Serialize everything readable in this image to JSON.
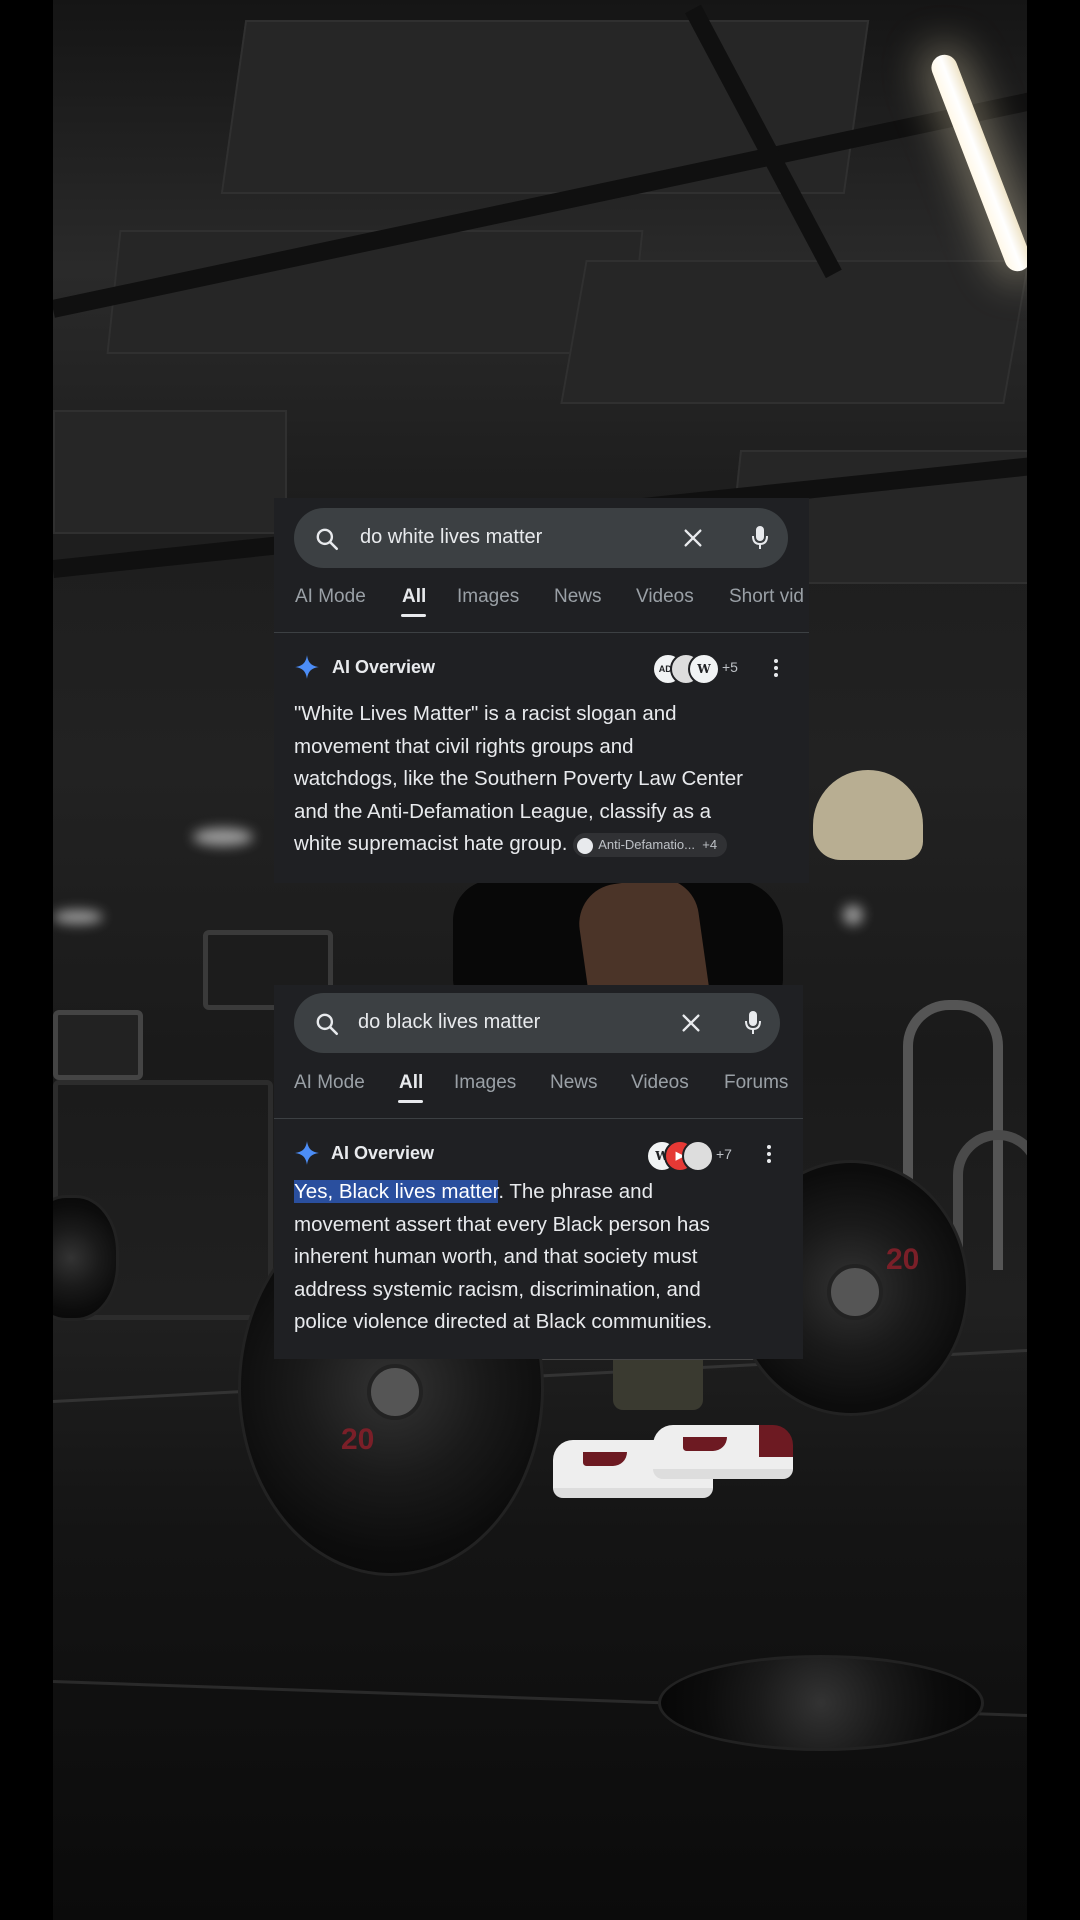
{
  "colors": {
    "panel_bg": "#1f2023",
    "search_bg": "#3c4043",
    "text_primary": "#e8eaed",
    "text_muted": "#9aa0a6",
    "highlight": "#2a4f9e",
    "sparkle_blue": "#4c8df6"
  },
  "top_result": {
    "search": {
      "query": "do white lives matter",
      "left_icon": "search-icon",
      "clear_icon": "close-icon",
      "mic_icon": "mic-icon"
    },
    "tabs": [
      "AI Mode",
      "All",
      "Images",
      "News",
      "Videos",
      "Short vid"
    ],
    "active_tab": "All",
    "ai_overview": {
      "title": "AI Overview",
      "sources_count": "+5",
      "text": "\"White Lives Matter\" is a racist slogan and movement that civil rights groups and watchdogs, like the Southern Poverty Law Center and the Anti-Defamation League, classify as a white supremacist hate group.",
      "lines": [
        "\"White Lives Matter\" is a racist slogan and",
        "movement that civil rights groups and",
        "watchdogs, like the Southern Poverty Law Center",
        "and the Anti-Defamation League, classify as a",
        "white supremacist hate group."
      ],
      "citation_label": "Anti-Defamatio...",
      "citation_count": "+4"
    }
  },
  "bottom_result": {
    "search": {
      "query": "do black lives matter",
      "left_icon": "search-icon",
      "clear_icon": "close-icon",
      "mic_icon": "mic-icon"
    },
    "tabs": [
      "AI Mode",
      "All",
      "Images",
      "News",
      "Videos",
      "Forums"
    ],
    "active_tab": "All",
    "ai_overview": {
      "title": "AI Overview",
      "sources_count": "+7",
      "highlight": "Yes, Black lives matter",
      "lines": [
        ". The phrase and",
        "movement assert that every Black person has",
        "inherent human worth, and that society must",
        "address systemic racism, discrimination, and",
        "police violence directed at Black communities."
      ]
    }
  }
}
